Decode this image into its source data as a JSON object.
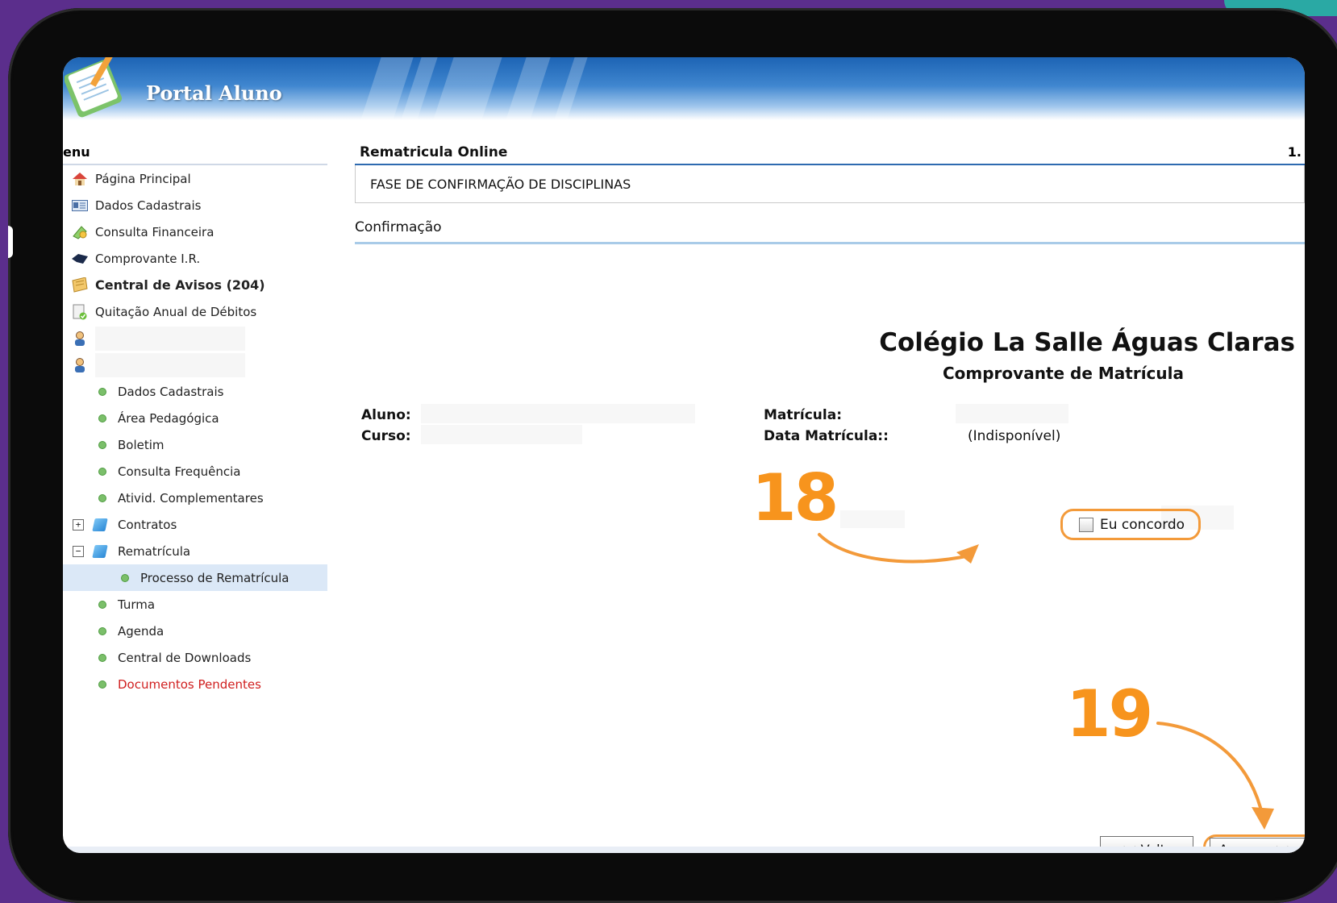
{
  "app": {
    "title": "Portal Aluno"
  },
  "sidebar": {
    "menu_title": "enu",
    "items": [
      {
        "label": "Página Principal",
        "icon": "house-icon"
      },
      {
        "label": "Dados Cadastrais",
        "icon": "id-card-icon"
      },
      {
        "label": "Consulta Financeira",
        "icon": "money-icon"
      },
      {
        "label": "Comprovante I.R.",
        "icon": "lion-icon"
      },
      {
        "label": "Central de Avisos (204)",
        "icon": "megaphone-icon"
      },
      {
        "label": "Quitação Anual de Débitos",
        "icon": "document-check-icon"
      }
    ],
    "student_items": [
      "Dados Cadastrais",
      "Área Pedagógica",
      "Boletim",
      "Consulta Frequência",
      "Ativid. Complementares"
    ],
    "contratos": "Contratos",
    "rematricula": "Rematrícula",
    "processo": "Processo de Rematrícula",
    "after_items": [
      "Turma",
      "Agenda",
      "Central de Downloads"
    ],
    "pending": "Documentos Pendentes",
    "tree_plus": "+",
    "tree_minus": "−"
  },
  "main": {
    "section_title": "Rematricula Online",
    "section_right": "1.",
    "phase": "FASE DE CONFIRMAÇÃO DE DISCIPLINAS",
    "confirm_label": "Confirmação",
    "school_name": "Colégio La Salle Águas Claras",
    "doc_title": "Comprovante de Matrícula",
    "fields": {
      "aluno_label": "Aluno:",
      "curso_label": "Curso:",
      "matricula_label": "Matrícula:",
      "data_label": "Data Matrícula::",
      "data_value": "(Indisponível)"
    },
    "agree_label": "Eu concordo",
    "agree_checked": false,
    "step18": "18",
    "step19": "19",
    "back_button": "<< Voltar",
    "next_button": "Avançar >>"
  },
  "colors": {
    "annotation": "#f7941d",
    "header_blue": "#1d63b4",
    "pending_red": "#d01f1f"
  }
}
